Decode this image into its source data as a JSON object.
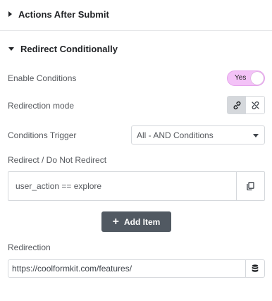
{
  "sections": {
    "actions_after_submit": {
      "title": "Actions After Submit",
      "expanded": false
    },
    "redirect_conditionally": {
      "title": "Redirect Conditionally",
      "expanded": true
    }
  },
  "enable_conditions": {
    "label": "Enable Conditions",
    "toggle_text": "Yes",
    "on": true
  },
  "redirection_mode": {
    "label": "Redirection mode",
    "options": [
      "link-icon",
      "unlink-icon"
    ],
    "selected": "link-icon"
  },
  "conditions_trigger": {
    "label": "Conditions Trigger",
    "value": "All - AND Conditions"
  },
  "redirect_rules": {
    "label": "Redirect / Do Not Redirect",
    "items": [
      "user_action == explore"
    ]
  },
  "add_item": {
    "label": "Add Item"
  },
  "redirection": {
    "label": "Redirection",
    "url": "https://coolformkit.com/features/"
  },
  "colors": {
    "toggle_on": "#f3c2f7",
    "button_dark": "#515962",
    "border": "#d5d8dc"
  }
}
